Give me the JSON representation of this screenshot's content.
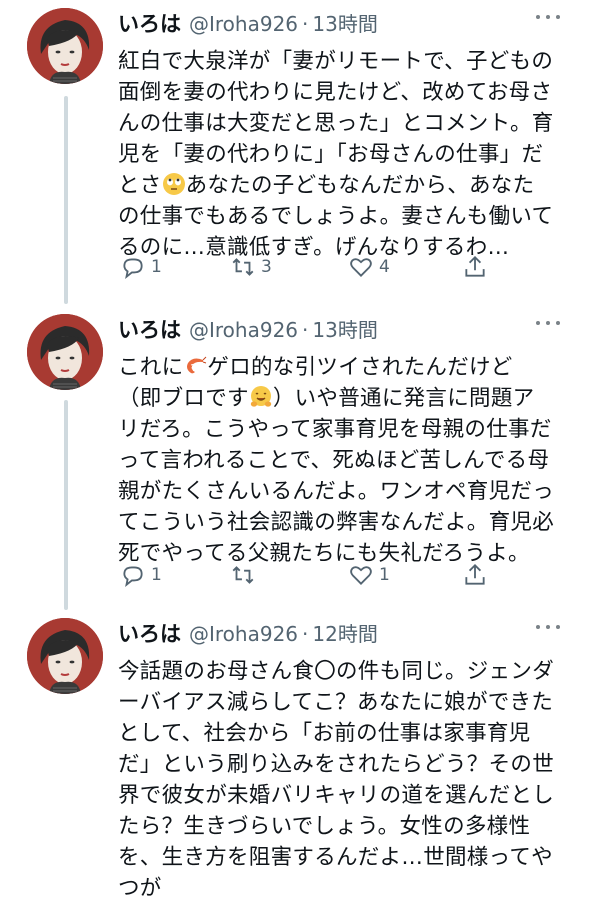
{
  "tweets": [
    {
      "name": "いろは",
      "handle": "@Iroha926",
      "separator": "·",
      "time": "13時間",
      "lines": [
        "紅白で大泉洋が「妻がリモートで、子どもの",
        "面倒を妻の代わりに見たけど、改めてお母さ",
        "んの仕事は大変だと思った」とコメント。育",
        "児を「妻の代わりに」「お母さんの仕事」だ",
        [
          "とさ",
          "あなたの子どもなんだから、あなた"
        ],
        "の仕事でもあるでしょうよ。妻さんも働いて",
        "るのに…意識低すぎ。げんなりするわ…"
      ],
      "emoji": "rolling-eyes-emoji",
      "reply_count": "1",
      "retweet_count": "3",
      "like_count": "4"
    },
    {
      "name": "いろは",
      "handle": "@Iroha926",
      "separator": "·",
      "time": "13時間",
      "lines": [
        [
          "これに",
          "ゲロ的な引ツイされたんだけど"
        ],
        [
          "（即ブロです",
          "）いや普通に発言に問題ア"
        ],
        "リだろ。こうやって家事育児を母親の仕事だ",
        "って言われることで、死ぬほど苦しんでる母",
        "親がたくさんいるんだよ。ワンオペ育児だっ",
        "てこういう社会認識の弊害なんだよ。育児必",
        "死でやってる父親たちにも失礼だろうよ。"
      ],
      "emoji": [
        "shrimp-emoji",
        "hugging-face-emoji"
      ],
      "reply_count": "1",
      "retweet_count": "",
      "like_count": "1"
    },
    {
      "name": "いろは",
      "handle": "@Iroha926",
      "separator": "·",
      "time": "12時間",
      "lines": [
        "今話題のお母さん食〇の件も同じ。ジェンダ",
        "ーバイアス減らしてこ？あなたに娘ができた",
        "として、社会から「お前の仕事は家事育児",
        "だ」という刷り込みをされたらどう？その世",
        "界で彼女が未婚バリキャリの道を選んだとし",
        "たら？生きづらいでしょう。女性の多様性",
        "を、生き方を阻害するんだよ…世間様ってや",
        "つが"
      ]
    }
  ],
  "icons": {
    "reply": "reply-icon",
    "retweet": "retweet-icon",
    "like": "heart-icon",
    "share": "share-icon",
    "more": "more-options-icon"
  },
  "colors": {
    "name": "#0f1419",
    "secondary": "#536471",
    "thread_line": "#cfd9de",
    "avatar_bg": "#a83a32"
  }
}
